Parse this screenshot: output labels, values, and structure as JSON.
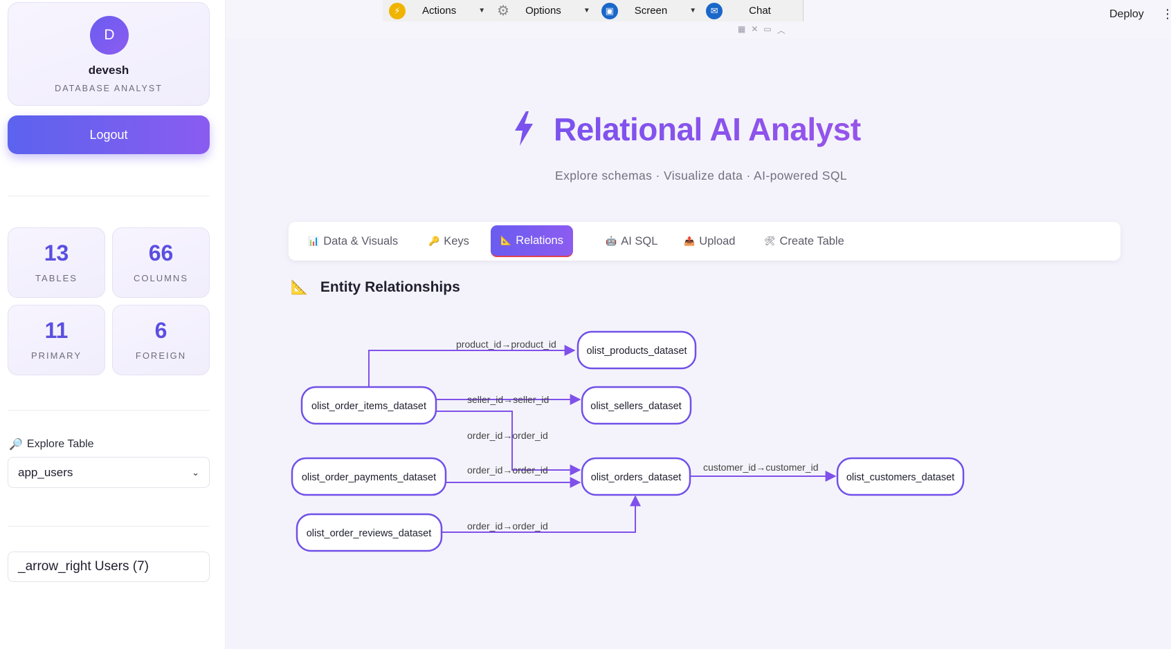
{
  "profile": {
    "initial": "D",
    "name": "devesh",
    "role": "DATABASE ANALYST"
  },
  "logout_label": "Logout",
  "stats": [
    {
      "value": "13",
      "label": "TABLES"
    },
    {
      "value": "66",
      "label": "COLUMNS"
    },
    {
      "value": "11",
      "label": "PRIMARY"
    },
    {
      "value": "6",
      "label": "FOREIGN"
    }
  ],
  "explore": {
    "label": "Explore Table",
    "selected": "app_users"
  },
  "users_field": "_arrow_right Users (7)",
  "toolbar": {
    "actions": "Actions",
    "options": "Options",
    "screen": "Screen",
    "chat": "Chat"
  },
  "deploy_label": "Deploy",
  "header": {
    "title": "Relational AI Analyst",
    "subtitle": "Explore schemas · Visualize data · AI-powered SQL"
  },
  "tabs": [
    {
      "icon": "📊",
      "label": "Data & Visuals"
    },
    {
      "icon": "🔑",
      "label": "Keys"
    },
    {
      "icon": "📐",
      "label": "Relations"
    },
    {
      "icon": "🤖",
      "label": "AI SQL"
    },
    {
      "icon": "📤",
      "label": "Upload"
    },
    {
      "icon": "🛠",
      "label": "Create Table"
    }
  ],
  "section": {
    "title": "Entity Relationships"
  },
  "diagram": {
    "nodes": [
      "olist_products_dataset",
      "olist_order_items_dataset",
      "olist_sellers_dataset",
      "olist_order_payments_dataset",
      "olist_orders_dataset",
      "olist_customers_dataset",
      "olist_order_reviews_dataset"
    ],
    "edges": [
      "product_id→product_id",
      "seller_id→seller_id",
      "order_id→order_id",
      "order_id→order_id",
      "customer_id→customer_id",
      "order_id→order_id"
    ]
  }
}
